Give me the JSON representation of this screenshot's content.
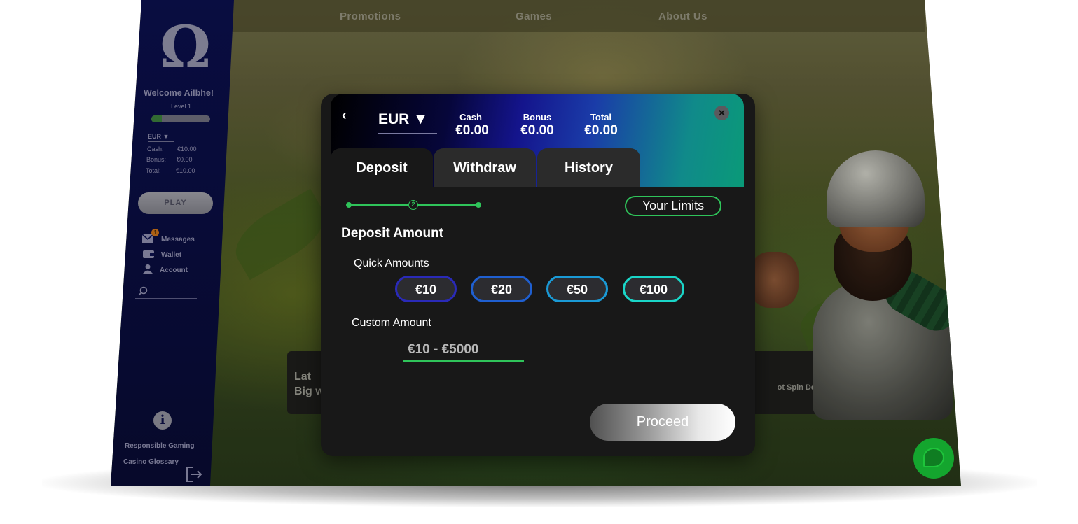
{
  "topnav": {
    "items": [
      "Promotions",
      "Games",
      "About Us"
    ]
  },
  "sidebar": {
    "welcome": "Welcome Ailbhe!",
    "level": "Level 1",
    "level_progress": 0.18,
    "currency": "EUR ▼",
    "balances": [
      {
        "label": "Cash:",
        "value": "€10.00"
      },
      {
        "label": "Bonus:",
        "value": "€0.00"
      },
      {
        "label": "Total:",
        "value": "€10.00"
      }
    ],
    "play_label": "PLAY",
    "messages_badge": "1",
    "links": [
      "Messages",
      "Wallet",
      "Account"
    ],
    "footer_links": [
      "Responsible Gaming",
      "Casino Glossary"
    ],
    "info_icon": "i"
  },
  "background_cards": {
    "left_text": "Lat\nBig w",
    "right_text": "ot Spin Deluxe"
  },
  "modal": {
    "back_icon": "‹",
    "currency": "EUR ▼",
    "balances": [
      {
        "label": "Cash",
        "value": "€0.00"
      },
      {
        "label": "Bonus",
        "value": "€0.00"
      },
      {
        "label": "Total",
        "value": "€0.00"
      }
    ],
    "close_icon": "✕",
    "tabs": [
      "Deposit",
      "Withdraw",
      "History"
    ],
    "active_tab": "Deposit",
    "stepper_current": "2",
    "limits_label": "Your Limits",
    "section_title": "Deposit Amount",
    "quick_label": "Quick Amounts",
    "quick_amounts": [
      "€10",
      "€20",
      "€50",
      "€100"
    ],
    "custom_label": "Custom Amount",
    "custom_placeholder": "€10 - €5000",
    "proceed_label": "Proceed"
  },
  "colors": {
    "accent_green": "#2fc45a",
    "quick_borders": [
      "#2a2ab8",
      "#1f5fd0",
      "#1a9ad6",
      "#1ad6c8"
    ]
  }
}
